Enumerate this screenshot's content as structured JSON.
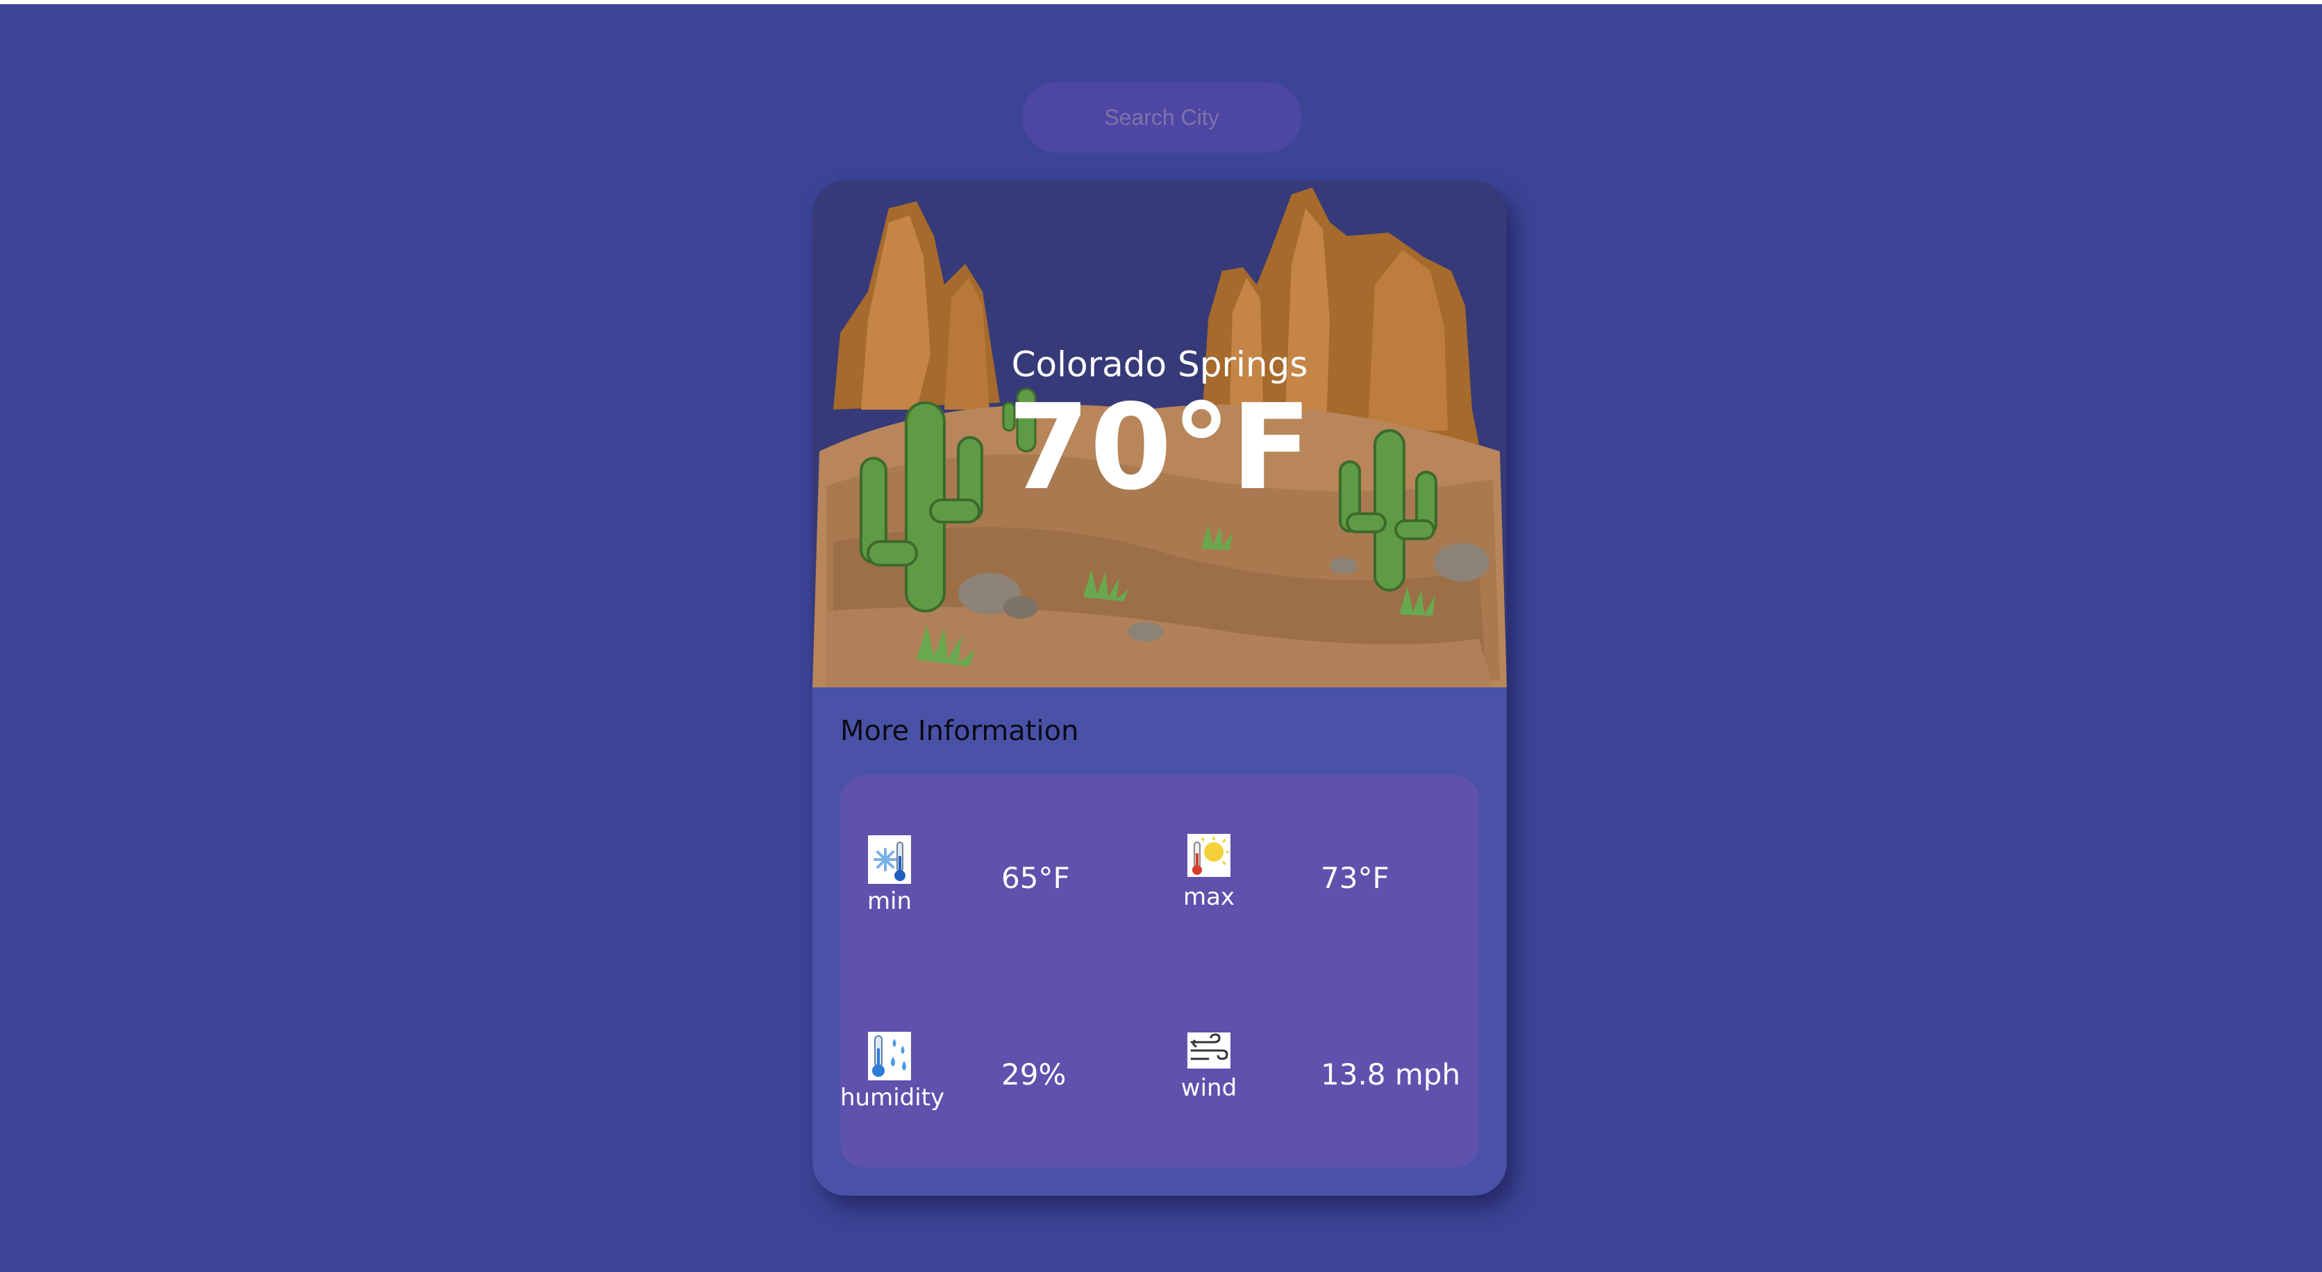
{
  "search": {
    "placeholder": "Search City"
  },
  "weather": {
    "city": "Colorado Springs",
    "temperature": "70°F"
  },
  "more_info": {
    "title": "More Information",
    "stats": [
      {
        "label": "min",
        "value": "65°F",
        "icon": "snow-thermometer-icon"
      },
      {
        "label": "max",
        "value": "73°F",
        "icon": "sun-thermometer-icon"
      },
      {
        "label": "humidity",
        "value": "29%",
        "icon": "humidity-icon"
      },
      {
        "label": "wind",
        "value": "13.8 mph",
        "icon": "wind-icon"
      }
    ]
  },
  "colors": {
    "background": "#3c4495",
    "card": "#4a52a8",
    "panel": "#5e52ad",
    "search": "#4d46a3"
  }
}
